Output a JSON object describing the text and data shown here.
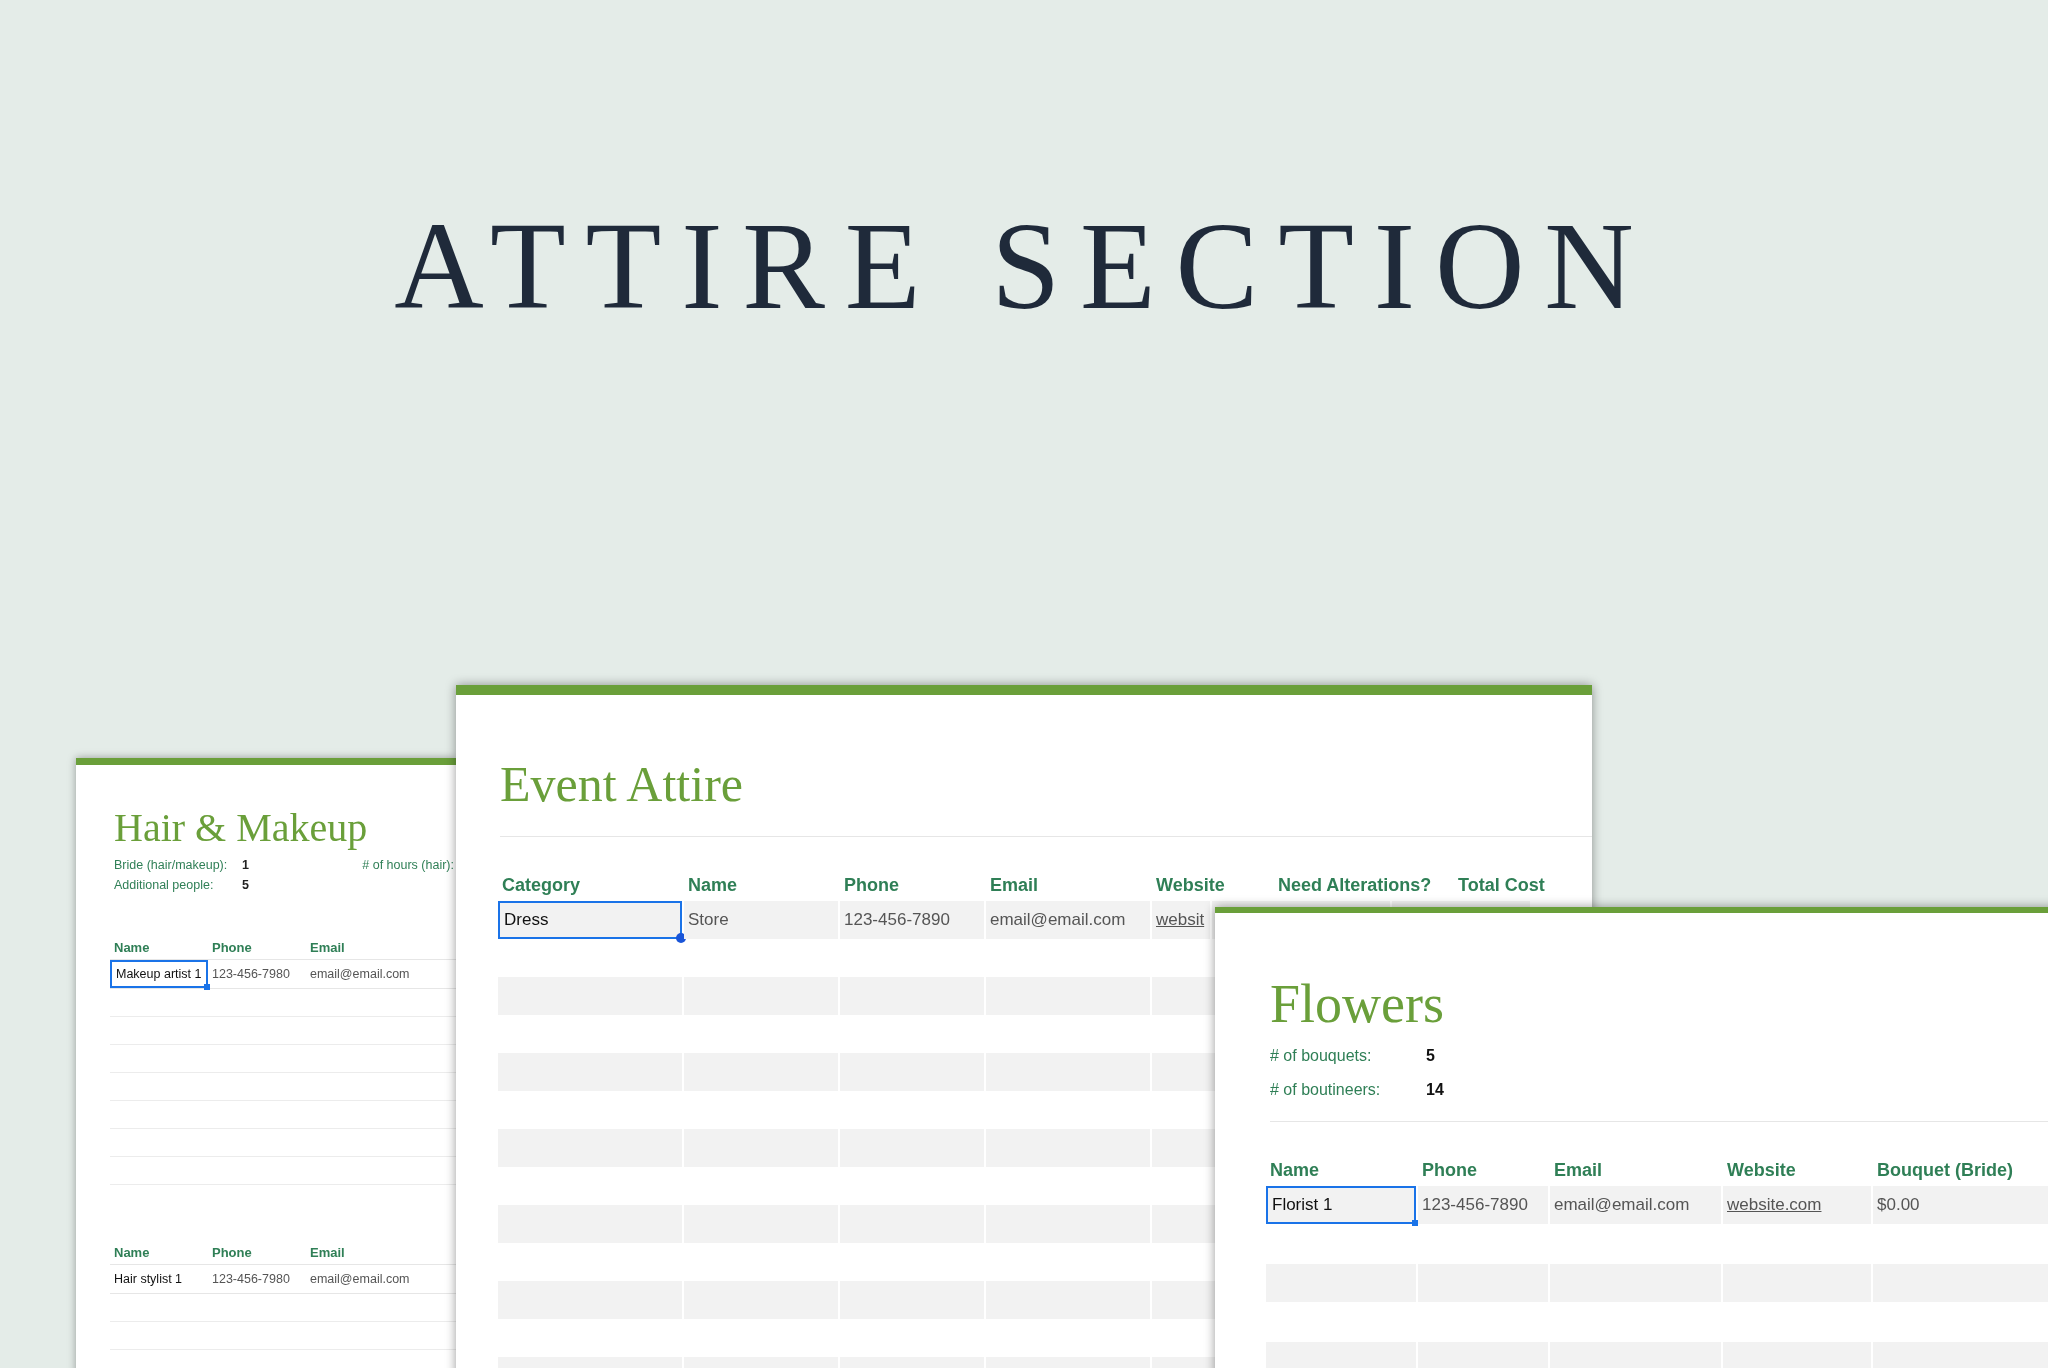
{
  "title": "ATTIRE SECTION",
  "hair_makeup": {
    "heading": "Hair & Makeup",
    "fields": [
      {
        "label": "Bride (hair/makeup):",
        "value": "1"
      },
      {
        "label": "Additional people:",
        "value": "5"
      }
    ],
    "extra_label": "# of hours (hair):",
    "tables": [
      {
        "columns": [
          "Name",
          "Phone",
          "Email"
        ],
        "rows": [
          [
            {
              "text": "Makeup artist 1",
              "kind": "name",
              "selected": true
            },
            {
              "text": "123-456-7980",
              "kind": "detail",
              "selected": false
            },
            {
              "text": "email@email.com",
              "kind": "detail",
              "selected": false
            }
          ]
        ]
      },
      {
        "columns": [
          "Name",
          "Phone",
          "Email"
        ],
        "rows": [
          [
            {
              "text": "Hair stylist 1",
              "kind": "name",
              "selected": false
            },
            {
              "text": "123-456-7980",
              "kind": "detail",
              "selected": false
            },
            {
              "text": "email@email.com",
              "kind": "detail",
              "selected": false
            }
          ]
        ]
      }
    ]
  },
  "event_attire": {
    "heading": "Event Attire",
    "columns": [
      "Category",
      "Name",
      "Phone",
      "Email",
      "Website",
      "Need Alterations?",
      "Total Cost"
    ],
    "rows": [
      [
        {
          "text": "Dress",
          "kind": "name",
          "selected": true
        },
        {
          "text": "Store",
          "kind": "detail",
          "selected": false
        },
        {
          "text": "123-456-7890",
          "kind": "detail",
          "selected": false
        },
        {
          "text": "email@email.com",
          "kind": "detail",
          "selected": false
        },
        {
          "text": "websit",
          "kind": "link",
          "selected": false
        }
      ]
    ]
  },
  "flowers": {
    "heading": "Flowers",
    "fields": [
      {
        "label": "# of bouquets:",
        "value": "5"
      },
      {
        "label": "# of boutineers:",
        "value": "14"
      }
    ],
    "columns": [
      "Name",
      "Phone",
      "Email",
      "Website",
      "Bouquet (Bride)"
    ],
    "rows": [
      [
        {
          "text": "Florist 1",
          "kind": "name",
          "selected": true
        },
        {
          "text": "123-456-7890",
          "kind": "detail",
          "selected": false
        },
        {
          "text": "email@email.com",
          "kind": "detail",
          "selected": false
        },
        {
          "text": "website.com",
          "kind": "link",
          "selected": false
        },
        {
          "text": "$0.00",
          "kind": "detail",
          "selected": false
        }
      ]
    ]
  }
}
